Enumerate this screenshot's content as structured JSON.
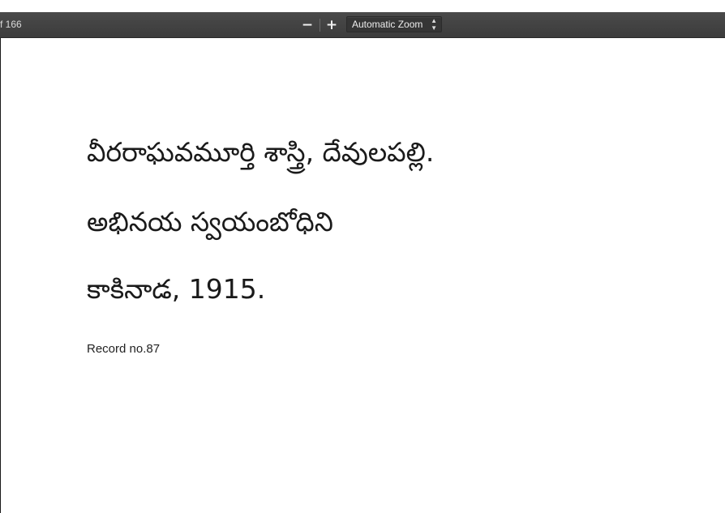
{
  "toolbar": {
    "page_count": "f 166",
    "zoom_out_label": "−",
    "zoom_in_label": "+",
    "zoom_value": "Automatic Zoom",
    "select_arrow_up": "▲",
    "select_arrow_down": "▼"
  },
  "document": {
    "author_line": "వీరరాఘవమూర్తి శాస్త్రి, దేవులపల్లి.",
    "title_line": "అభినయ స్వయంబోధిని",
    "place_year_line": "కాకినాడ, 1915.",
    "record_line": "Record no.87"
  },
  "colors": {
    "toolbar_bg": "#404040",
    "page_bg": "#ffffff",
    "text": "#1a1a1a"
  }
}
